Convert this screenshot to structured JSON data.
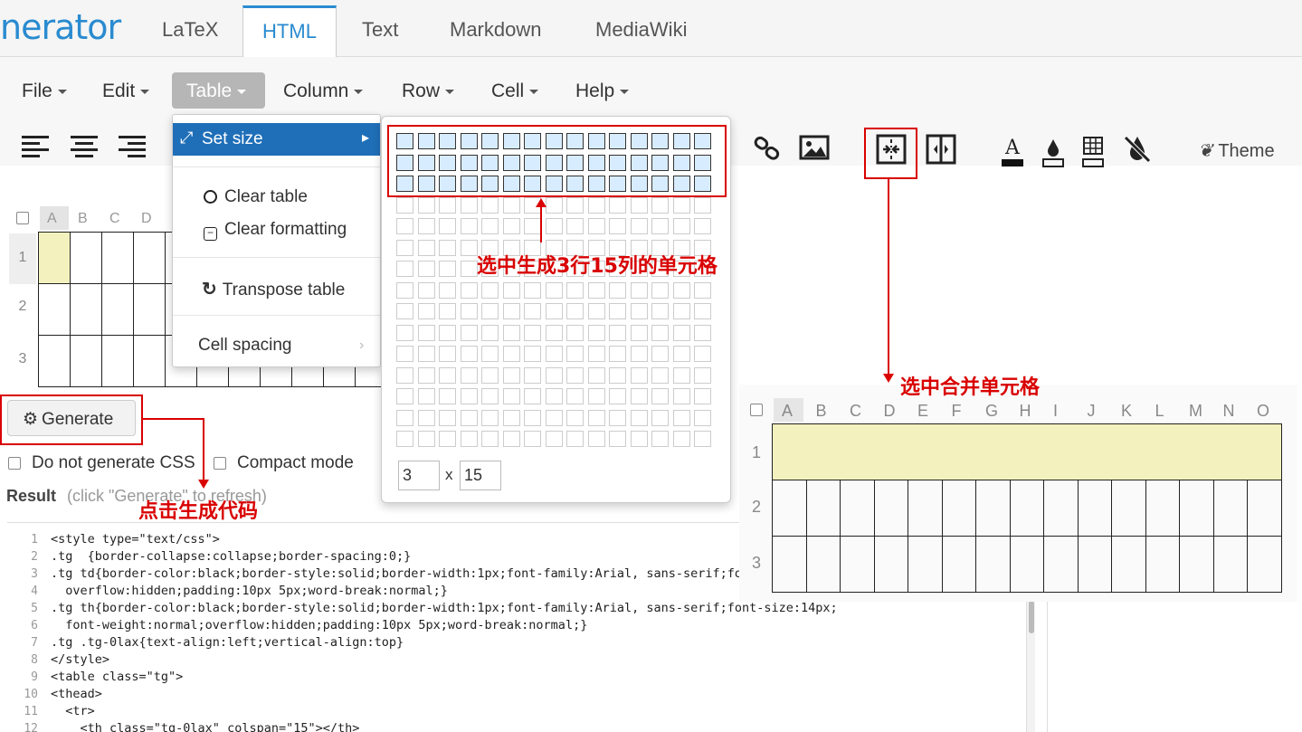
{
  "header": {
    "logo": "nerator",
    "tabs": [
      "LaTeX",
      "HTML",
      "Text",
      "Markdown",
      "MediaWiki"
    ],
    "active_tab": "HTML"
  },
  "menubar": {
    "items": [
      "File",
      "Edit",
      "Table",
      "Column",
      "Row",
      "Cell",
      "Help"
    ],
    "active": "Table"
  },
  "toolbar": {
    "theme_label": "Theme"
  },
  "editor": {
    "columns": [
      "A",
      "B",
      "C",
      "D"
    ],
    "rows": [
      "1",
      "2",
      "3"
    ]
  },
  "dropdown": {
    "set_size": "Set size",
    "clear_table": "Clear table",
    "clear_formatting": "Clear formatting",
    "transpose_table": "Transpose table",
    "cell_spacing": "Cell spacing"
  },
  "size_picker": {
    "rows_value": "3",
    "x_label": "x",
    "cols_value": "15",
    "grid_rows": 15,
    "grid_cols": 15,
    "selected_rows": 3,
    "selected_cols": 15
  },
  "generate": {
    "button_label": "Generate",
    "option_no_css": "Do not generate CSS",
    "option_compact": "Compact mode",
    "result_label": "Result",
    "result_hint": "(click \"Generate\" to refresh)"
  },
  "code_lines": [
    "<style type=\"text/css\">",
    ".tg  {border-collapse:collapse;border-spacing:0;}",
    ".tg td{border-color:black;border-style:solid;border-width:1px;font-family:Arial, sans-serif;fon",
    "  overflow:hidden;padding:10px 5px;word-break:normal;}",
    ".tg th{border-color:black;border-style:solid;border-width:1px;font-family:Arial, sans-serif;font-size:14px;",
    "  font-weight:normal;overflow:hidden;padding:10px 5px;word-break:normal;}",
    ".tg .tg-0lax{text-align:left;vertical-align:top}",
    "</style>",
    "<table class=\"tg\">",
    "<thead>",
    "  <tr>",
    "    <th class=\"tg-0lax\" colspan=\"15\"></th>"
  ],
  "preview": {
    "columns": [
      "A",
      "B",
      "C",
      "D",
      "E",
      "F",
      "G",
      "H",
      "I",
      "J",
      "K",
      "L",
      "M",
      "N",
      "O"
    ],
    "rows": [
      "1",
      "2",
      "3"
    ]
  },
  "annotations": {
    "select_size": "选中生成3行15列的单元格",
    "merge_cells": "选中合并单元格",
    "click_generate": "点击生成代码"
  },
  "colors": {
    "accent": "#2a8bd0",
    "selected_menu": "#1f6fb8",
    "annotation": "#d90000",
    "merged_cell": "#f3f2bf"
  }
}
